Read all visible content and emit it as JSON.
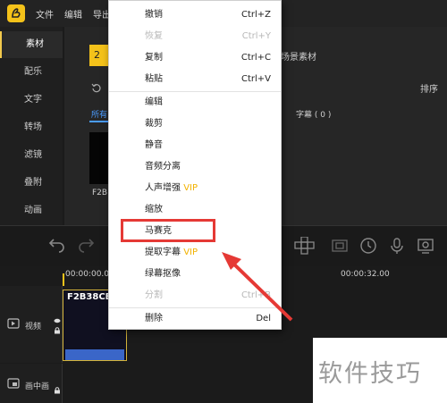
{
  "topbar": {
    "menus": [
      "文件",
      "编辑",
      "导出"
    ]
  },
  "sidebar": {
    "items": [
      {
        "label": "素材",
        "active": true
      },
      {
        "label": "配乐"
      },
      {
        "label": "文字"
      },
      {
        "label": "转场"
      },
      {
        "label": "滤镜"
      },
      {
        "label": "叠附"
      },
      {
        "label": "动画"
      }
    ]
  },
  "main": {
    "yellow_tab": "2",
    "scene_tab": "场景素材",
    "sort_label": "排序",
    "all_label": "所有",
    "subtitle_label": "字幕 ( 0 )",
    "thumb_label": "F2B"
  },
  "timeline": {
    "time_start": "00:00:00.00",
    "time_end": "00:00:32.00",
    "tracks": [
      {
        "label": "视频"
      },
      {
        "label": "画中画"
      }
    ],
    "clip_title": "F2B38CB"
  },
  "context_menu": {
    "items": [
      {
        "label": "撤销",
        "shortcut": "Ctrl+Z",
        "disabled": false
      },
      {
        "label": "恢复",
        "shortcut": "Ctrl+Y",
        "disabled": true
      },
      {
        "label": "复制",
        "shortcut": "Ctrl+C",
        "disabled": false
      },
      {
        "label": "粘贴",
        "shortcut": "Ctrl+V",
        "disabled": false
      },
      {
        "label": "编辑",
        "shortcut": "",
        "disabled": false
      },
      {
        "label": "裁剪",
        "shortcut": "",
        "disabled": false
      },
      {
        "label": "静音",
        "shortcut": "",
        "disabled": false
      },
      {
        "label": "音频分离",
        "shortcut": "",
        "disabled": false
      },
      {
        "label": "人声增强",
        "vip": "VIP",
        "shortcut": "",
        "disabled": false
      },
      {
        "label": "缩放",
        "shortcut": "",
        "disabled": false
      },
      {
        "label": "马赛克",
        "shortcut": "",
        "disabled": false,
        "highlighted": true
      },
      {
        "label": "提取字幕",
        "vip": "VIP",
        "shortcut": "",
        "disabled": false
      },
      {
        "label": "绿幕抠像",
        "shortcut": "",
        "disabled": false
      },
      {
        "label": "分割",
        "shortcut": "Ctrl+B",
        "disabled": true
      },
      {
        "label": "删除",
        "shortcut": "Del",
        "disabled": false
      }
    ]
  },
  "watermark": {
    "text": "软件技巧"
  },
  "colors": {
    "accent_yellow": "#f4c21a",
    "link_blue": "#4a9cff",
    "vip_gold": "#f2b200",
    "annotation_red": "#e53935"
  },
  "icons": [
    "app-logo-icon",
    "undo-icon",
    "redo-icon",
    "crop-icon",
    "speed-icon",
    "voice-icon",
    "video-track-icon",
    "pip-track-icon",
    "eye-icon",
    "lock-icon"
  ]
}
